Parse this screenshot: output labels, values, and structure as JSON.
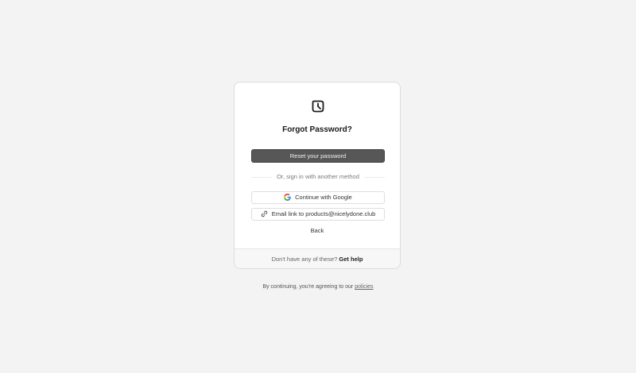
{
  "card": {
    "title": "Forgot Password?",
    "primary_button": "Reset your password",
    "divider_text": "Or, sign in with another method",
    "google_button": "Continue with Google",
    "email_button": "Email link to products@nicelydone.club",
    "back_link": "Back",
    "footer_text": "Don't have any of these?",
    "footer_link": "Get help"
  },
  "page_footer": {
    "text": "By continuing, you're agreeing to our",
    "link": "policies"
  },
  "icons": {
    "logo": "clock-square-logo-icon",
    "google": "google-icon",
    "link": "link-icon"
  },
  "colors": {
    "background": "#f3f3f4",
    "primary_button": "#575757",
    "card": "#ffffff"
  }
}
